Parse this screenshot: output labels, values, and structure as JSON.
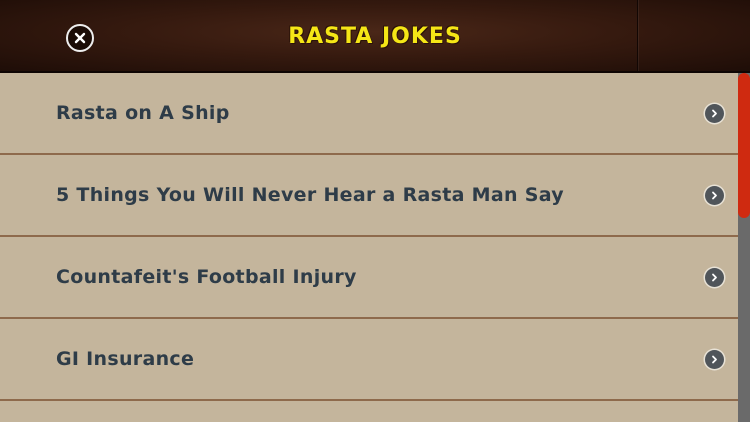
{
  "header": {
    "title": "RASTA JOKES",
    "close_icon": "close-circle-icon"
  },
  "list": {
    "items": [
      {
        "label": "Rasta on A Ship",
        "icon": "chevron-right-circle-icon"
      },
      {
        "label": "5 Things You Will Never Hear a Rasta Man Say",
        "icon": "chevron-right-circle-icon"
      },
      {
        "label": "Countafeit's Football Injury",
        "icon": "chevron-right-circle-icon"
      },
      {
        "label": "GI Insurance",
        "icon": "chevron-right-circle-icon"
      }
    ]
  },
  "scrollbar": {
    "position": 0,
    "visible_fraction": 0.42
  },
  "colors": {
    "header_bg": "#361a0f",
    "title": "#f5e616",
    "row_bg": "#c4b59c",
    "row_text": "#2e3c48",
    "row_divider": "#8e6a4c",
    "scroll_thumb": "#cf2a10"
  }
}
